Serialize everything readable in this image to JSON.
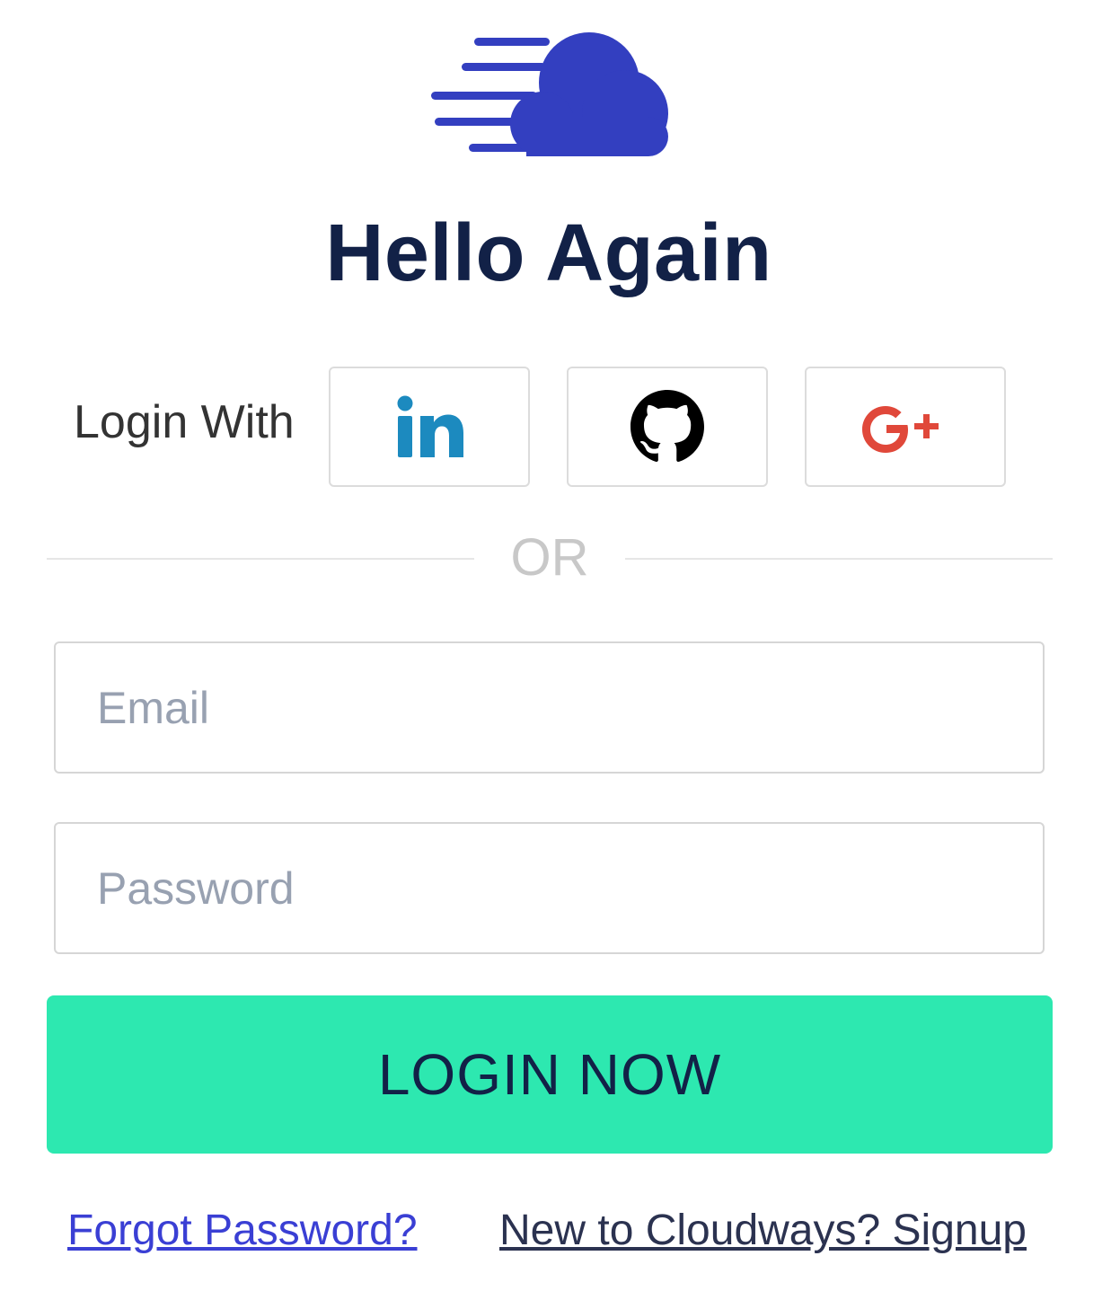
{
  "brand": {
    "logo_icon": "cloudways-cloud-logo",
    "logo_color": "#333FC0"
  },
  "heading": {
    "title": "Hello Again"
  },
  "social_login": {
    "label": "Login With",
    "providers": [
      {
        "name": "linkedin",
        "icon": "linkedin-icon",
        "glyph": "in",
        "color": "#1C8ABF"
      },
      {
        "name": "github",
        "icon": "github-icon",
        "color": "#000000"
      },
      {
        "name": "google-plus",
        "icon": "google-plus-icon",
        "glyph": "G+",
        "color": "#E0483A"
      }
    ]
  },
  "divider": {
    "text": "OR"
  },
  "form": {
    "email": {
      "value": "",
      "placeholder": "Email"
    },
    "password": {
      "value": "",
      "placeholder": "Password"
    },
    "submit_label": "LOGIN NOW",
    "submit_color": "#2DE8B0"
  },
  "links": {
    "forgot_password": "Forgot Password?",
    "signup": "New to Cloudways? Signup"
  }
}
